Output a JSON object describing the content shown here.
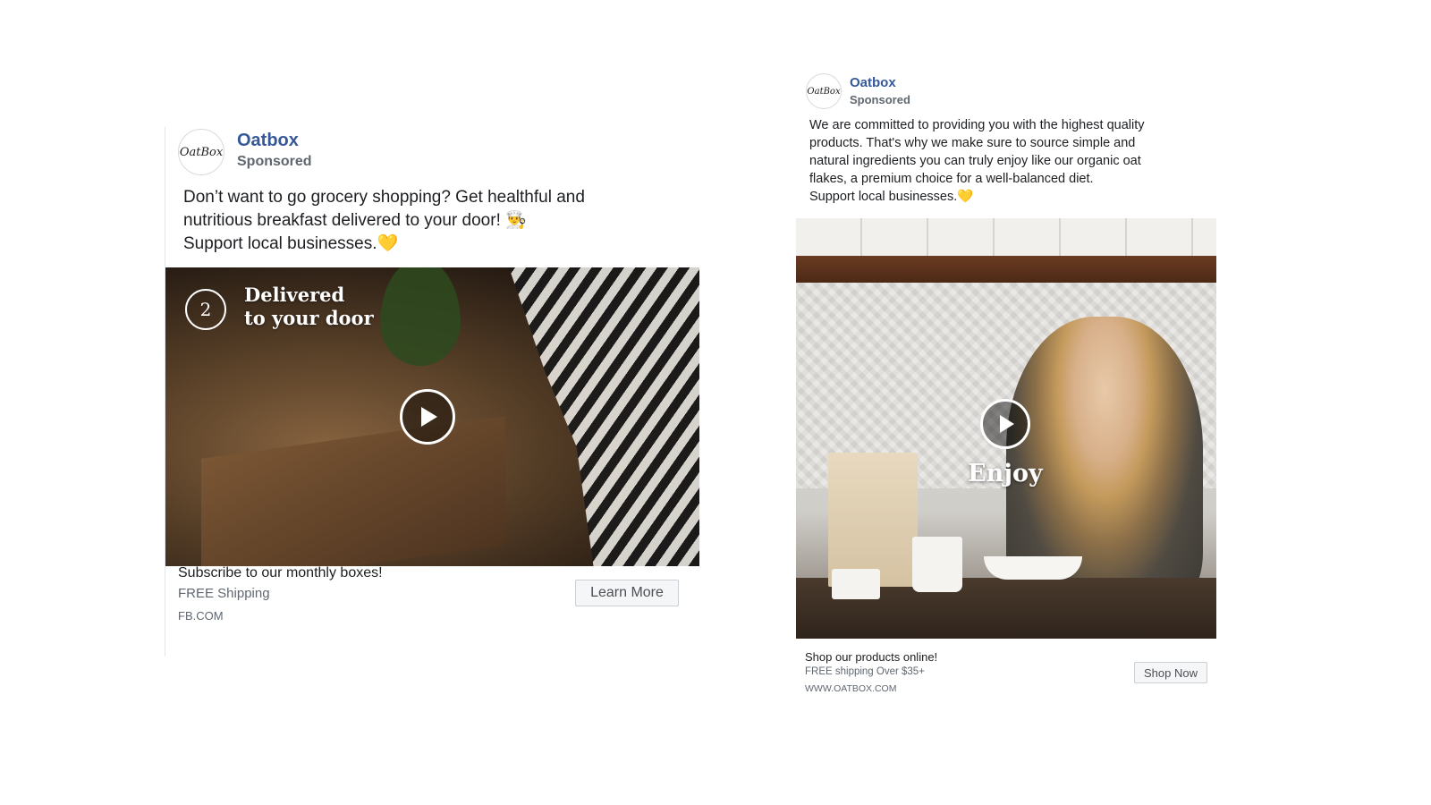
{
  "ad_left": {
    "logo_text": "OatBox",
    "page_name": "Oatbox",
    "sponsored": "Sponsored",
    "body_line1": "Don’t want to go grocery shopping? Get healthful and",
    "body_line2": "nutritious breakfast delivered to your door! 👨‍🍳",
    "body_line3": "Support local businesses.",
    "heart": "💛",
    "step_number": "2",
    "overlay_line1": "Delivered",
    "overlay_line2": "to your door",
    "icons": {
      "play": "play-icon"
    },
    "footer": {
      "title": "Subscribe to our monthly boxes!",
      "description": "FREE Shipping",
      "domain": "FB.COM"
    },
    "cta_label": "Learn More"
  },
  "ad_right": {
    "logo_text": "OatBox",
    "page_name": "Oatbox",
    "sponsored": "Sponsored",
    "body_line1": "We are committed to providing you with the highest quality",
    "body_line2": "products. That's why we make sure to source simple and",
    "body_line3": "natural ingredients you can truly enjoy like our organic oat",
    "body_line4": "flakes, a premium choice for a well-balanced diet.",
    "body_line5": "Support local businesses.",
    "heart": "💛",
    "overlay_text": "Enjoy",
    "icons": {
      "play": "play-icon"
    },
    "footer": {
      "title": "Shop our products online!",
      "description": "FREE shipping Over $35+",
      "domain": "WWW.OATBOX.COM"
    },
    "cta_label": "Shop Now"
  },
  "colors": {
    "page_name": "#365899",
    "secondary_text": "#606770",
    "primary_text": "#1c1e21",
    "cta_background": "#f5f6f7",
    "cta_border": "#ccd0d5",
    "heart": "#f5c518"
  }
}
